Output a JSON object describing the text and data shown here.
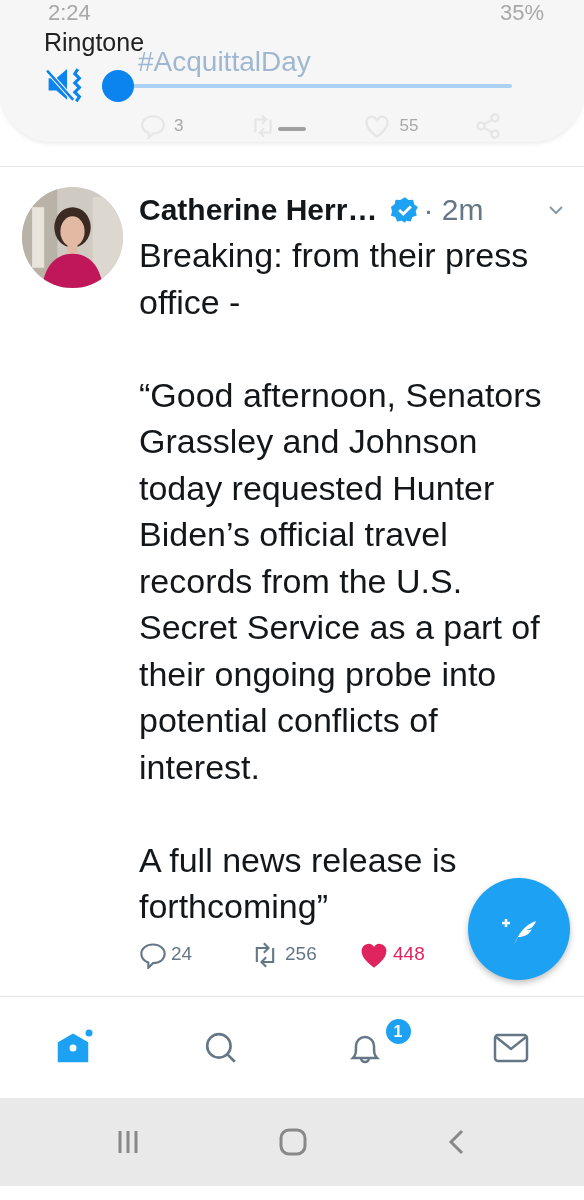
{
  "volume_panel": {
    "label": "Ringtone",
    "level": 0
  },
  "behind_panel": {
    "status_time": "2:24",
    "battery": "35%",
    "hashtag": "#AcquittalDay",
    "reply_count": "3",
    "like_count": "55"
  },
  "tweet": {
    "author": "Catherine Herr…",
    "verified": true,
    "time": "· 2m",
    "paragraphs": [
      "Breaking:  from their press office -",
      "“Good afternoon, Senators Grassley and Johnson today requested Hunter Biden’s official travel records from the U.S. Secret Service as a part of their ongoing probe into potential conflicts of interest.",
      "A full news release is forthcoming”"
    ],
    "replies": "24",
    "retweets": "256",
    "likes": "448",
    "liked": true
  },
  "bottom_nav": [
    {
      "kind": "home",
      "selected": true,
      "dot": true
    },
    {
      "kind": "search",
      "selected": false
    },
    {
      "kind": "notifications",
      "selected": false,
      "badge": "1"
    },
    {
      "kind": "messages",
      "selected": false
    }
  ]
}
